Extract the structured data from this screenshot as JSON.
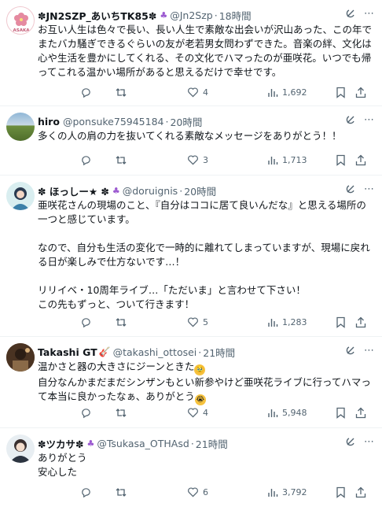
{
  "posts": [
    {
      "name": "✽JN2SZP_あいちTK85✽",
      "handle": "@Jn2Szp",
      "time": "18時間",
      "avatar_text": "ASAKA",
      "text": "お互い人生は色々で長い、長い人生で素敵な出会いが沢山あった、この年でまたバカ騒ぎできるぐらいの友が老若男女問わずできた。音楽の絆、文化は心や生活を豊かにしてくれる、その文化でハマったのが亜咲花。いつでも帰ってこれる温かい場所があると思えるだけで幸せです。",
      "reply_count": "",
      "retweet_count": "",
      "like_count": "4",
      "view_count": "1,692"
    },
    {
      "name": "hiro",
      "handle": "@ponsuke75945184",
      "time": "20時間",
      "text": "多くの人の肩の力を抜いてくれる素敵なメッセージをありがとう！！",
      "reply_count": "",
      "retweet_count": "",
      "like_count": "3",
      "view_count": "1,713"
    },
    {
      "name": "✽ ほっしー★ ✽",
      "handle": "@doruignis",
      "time": "20時間",
      "text": "亜咲花さんの現場のこと、『自分はココに居て良いんだな』と思える場所の一つと感じています。\n\nなので、自分も生活の変化で一時的に離れてしまっていますが、現場に戻れる日が楽しみで仕方ないです…！\n\nリリイベ・10周年ライブ…「ただいま」と言わせて下さい！\nこの先もずっと、ついて行きます！",
      "reply_count": "",
      "retweet_count": "",
      "like_count": "5",
      "view_count": "1,283"
    },
    {
      "name": "Takashi GT",
      "handle": "@takashi_ottosei",
      "time": "21時間",
      "text_lines": [
        "温かさと器の大きさにジーンときた",
        "自分なんかまだまだシンザンもとい新参やけど亜咲花ライブに行ってハマって本当に良かったなぁ、ありがとう"
      ],
      "reply_count": "",
      "retweet_count": "",
      "like_count": "4",
      "view_count": "5,948"
    },
    {
      "name": "✽ツカサ✽",
      "handle": "@Tsukasa_OTHAsd",
      "time": "21時間",
      "text": "ありがとう\n安心した",
      "reply_count": "",
      "retweet_count": "",
      "like_count": "6",
      "view_count": "3,792"
    }
  ],
  "colors": {
    "text": "#0f1419",
    "muted": "#536471",
    "badge": "#9b59d0",
    "border": "#eff3f4"
  },
  "icons": [
    "grok-icon",
    "more-icon",
    "reply-icon",
    "retweet-icon",
    "like-icon",
    "views-icon",
    "bookmark-icon",
    "share-icon"
  ]
}
